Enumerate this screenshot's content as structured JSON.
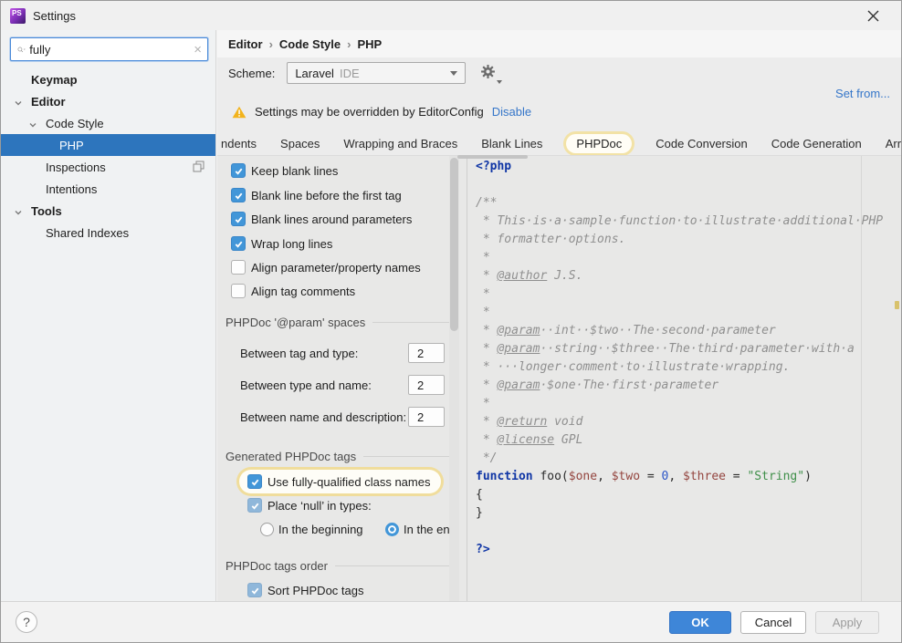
{
  "window": {
    "title": "Settings"
  },
  "colors": {
    "selection_blue": "#2d75bd",
    "checkbox_blue": "#4296d8",
    "link_blue": "#3576c9",
    "ok_button_blue": "#3e86d8",
    "search_highlight_ring": "#f0dd9c",
    "warning_yellow": "#f2b31c"
  },
  "icons": {
    "app_logo": "phpstorm-ps-square",
    "search": "magnifier-with-caret",
    "search_clear": "x",
    "window_close": "x",
    "warning": "warning-triangle",
    "scheme_gear": "gear-with-caret",
    "tree_chevron": "chevron-down",
    "tabs_overflow": "chevron-down",
    "inspections_badge": "copy-squares",
    "help": "?"
  },
  "sidebar": {
    "search": {
      "value": "fully"
    },
    "tree": [
      {
        "label": "Keymap"
      },
      {
        "label": "Editor"
      },
      {
        "label": "Code Style"
      },
      {
        "label": "PHP"
      },
      {
        "label": "Inspections"
      },
      {
        "label": "Intentions"
      },
      {
        "label": "Tools"
      },
      {
        "label": "Shared Indexes"
      }
    ]
  },
  "header": {
    "breadcrumb": [
      "Editor",
      "Code Style",
      "PHP"
    ],
    "sep": "›",
    "scheme_label": "Scheme:",
    "scheme_value": "Laravel",
    "scheme_suffix": "IDE",
    "set_from": "Set from...",
    "warning_text": "Settings may be overridden by EditorConfig",
    "warning_action": "Disable"
  },
  "tabs": {
    "selected": "PHPDoc",
    "items": [
      {
        "label": "ndents"
      },
      {
        "label": "Spaces"
      },
      {
        "label": "Wrapping and Braces"
      },
      {
        "label": "Blank Lines"
      },
      {
        "label": "PHPDoc"
      },
      {
        "label": "Code Conversion"
      },
      {
        "label": "Code Generation"
      },
      {
        "label": "Arrangement"
      }
    ]
  },
  "options": {
    "checkboxes": [
      {
        "label": "Keep blank lines",
        "checked": true
      },
      {
        "label": "Blank line before the first tag",
        "checked": true
      },
      {
        "label": "Blank lines around parameters",
        "checked": true
      },
      {
        "label": "Wrap long lines",
        "checked": true
      },
      {
        "label": "Align parameter/property names",
        "checked": false
      },
      {
        "label": "Align tag comments",
        "checked": false
      }
    ],
    "param_spaces": {
      "title": "PHPDoc '@param' spaces",
      "fields": [
        {
          "label": "Between tag and type:",
          "value": "2"
        },
        {
          "label": "Between type and name:",
          "value": "2"
        },
        {
          "label": "Between name and description:",
          "value": "2"
        }
      ]
    },
    "generated": {
      "title": "Generated PHPDoc tags",
      "fully_qualified": {
        "label": "Use fully-qualified class names",
        "checked": true,
        "highlighted": true
      },
      "place_null": {
        "label": "Place ‘null’ in types:",
        "checked": true
      },
      "radio": [
        {
          "label": "In the beginning",
          "selected": false
        },
        {
          "label": "In the end",
          "selected": true
        }
      ]
    },
    "order": {
      "title": "PHPDoc tags order",
      "sort": {
        "label": "Sort PHPDoc tags",
        "checked": true
      }
    }
  },
  "preview": {
    "lines": [
      [
        {
          "t": "<?php",
          "c": "tag"
        }
      ],
      [],
      [
        {
          "t": "/**",
          "c": "cmt"
        }
      ],
      [
        {
          "t": " * This·is·a·sample·function·to·illustrate·additional·PHP",
          "c": "cmt"
        }
      ],
      [
        {
          "t": " * formatter·options.",
          "c": "cmt"
        }
      ],
      [
        {
          "t": " *",
          "c": "cmt"
        }
      ],
      [
        {
          "t": " * ",
          "c": "cmt"
        },
        {
          "t": "@author",
          "c": "doc"
        },
        {
          "t": " J.S.",
          "c": "cmt"
        }
      ],
      [
        {
          "t": " *",
          "c": "cmt"
        }
      ],
      [
        {
          "t": " *",
          "c": "cmt"
        }
      ],
      [
        {
          "t": " * ",
          "c": "cmt"
        },
        {
          "t": "@param",
          "c": "doc"
        },
        {
          "t": "··int··$two··The·second·parameter",
          "c": "cmt"
        }
      ],
      [
        {
          "t": " * ",
          "c": "cmt"
        },
        {
          "t": "@param",
          "c": "doc"
        },
        {
          "t": "··string··$three··The·third·parameter·with·a",
          "c": "cmt"
        }
      ],
      [
        {
          "t": " * ···longer·comment·to·illustrate·wrapping.",
          "c": "cmt"
        }
      ],
      [
        {
          "t": " * ",
          "c": "cmt"
        },
        {
          "t": "@param",
          "c": "doc"
        },
        {
          "t": "·$one·The·first·parameter",
          "c": "cmt"
        }
      ],
      [
        {
          "t": " *",
          "c": "cmt"
        }
      ],
      [
        {
          "t": " * ",
          "c": "cmt"
        },
        {
          "t": "@return",
          "c": "doc"
        },
        {
          "t": " void",
          "c": "cmt"
        }
      ],
      [
        {
          "t": " * ",
          "c": "cmt"
        },
        {
          "t": "@license",
          "c": "doc"
        },
        {
          "t": " GPL",
          "c": "cmt"
        }
      ],
      [
        {
          "t": " */",
          "c": "cmt"
        }
      ],
      [
        {
          "t": "function",
          "c": "kw"
        },
        {
          "t": " foo(",
          "c": "pln"
        },
        {
          "t": "$one",
          "c": "var"
        },
        {
          "t": ", ",
          "c": "pln"
        },
        {
          "t": "$two",
          "c": "var"
        },
        {
          "t": " = ",
          "c": "pln"
        },
        {
          "t": "0",
          "c": "num"
        },
        {
          "t": ", ",
          "c": "pln"
        },
        {
          "t": "$three",
          "c": "var"
        },
        {
          "t": " = ",
          "c": "pln"
        },
        {
          "t": "\"String\"",
          "c": "str"
        },
        {
          "t": ")",
          "c": "pln"
        }
      ],
      [
        {
          "t": "{",
          "c": "pln"
        }
      ],
      [
        {
          "t": "}",
          "c": "pln"
        }
      ],
      [],
      [
        {
          "t": "?>",
          "c": "tag"
        }
      ]
    ]
  },
  "footer": {
    "help": "?",
    "ok": "OK",
    "cancel": "Cancel",
    "apply": "Apply"
  }
}
